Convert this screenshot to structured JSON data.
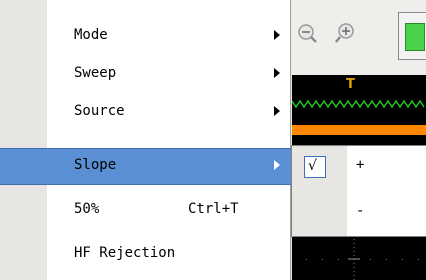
{
  "menu": {
    "items": [
      {
        "label": "Mode",
        "shortcut": "",
        "has_submenu": true
      },
      {
        "label": "Sweep",
        "shortcut": "",
        "has_submenu": true
      },
      {
        "label": "Source",
        "shortcut": "",
        "has_submenu": true
      },
      {
        "label": "Slope",
        "shortcut": "",
        "has_submenu": true
      },
      {
        "label": "50%",
        "shortcut": "Ctrl+T",
        "has_submenu": false
      },
      {
        "label": "HF Rejection",
        "shortcut": "",
        "has_submenu": false
      }
    ],
    "highlighted_item": "Slope"
  },
  "submenu": {
    "items": [
      {
        "label": "+",
        "checked": true,
        "check_glyph": "√"
      },
      {
        "label": "-",
        "checked": false
      }
    ]
  },
  "scope": {
    "trigger_label": "T"
  },
  "colors": {
    "highlight": "#5a8fd4",
    "menu_gutter": "#e7e6e3",
    "waveform": "#22c022",
    "trigger_bar": "#ff8800",
    "run_button": "#4bd04b"
  },
  "icons": [
    "zoom-out-icon",
    "zoom-in-icon",
    "run-icon",
    "submenu-arrow-icon",
    "checkmark-icon"
  ]
}
